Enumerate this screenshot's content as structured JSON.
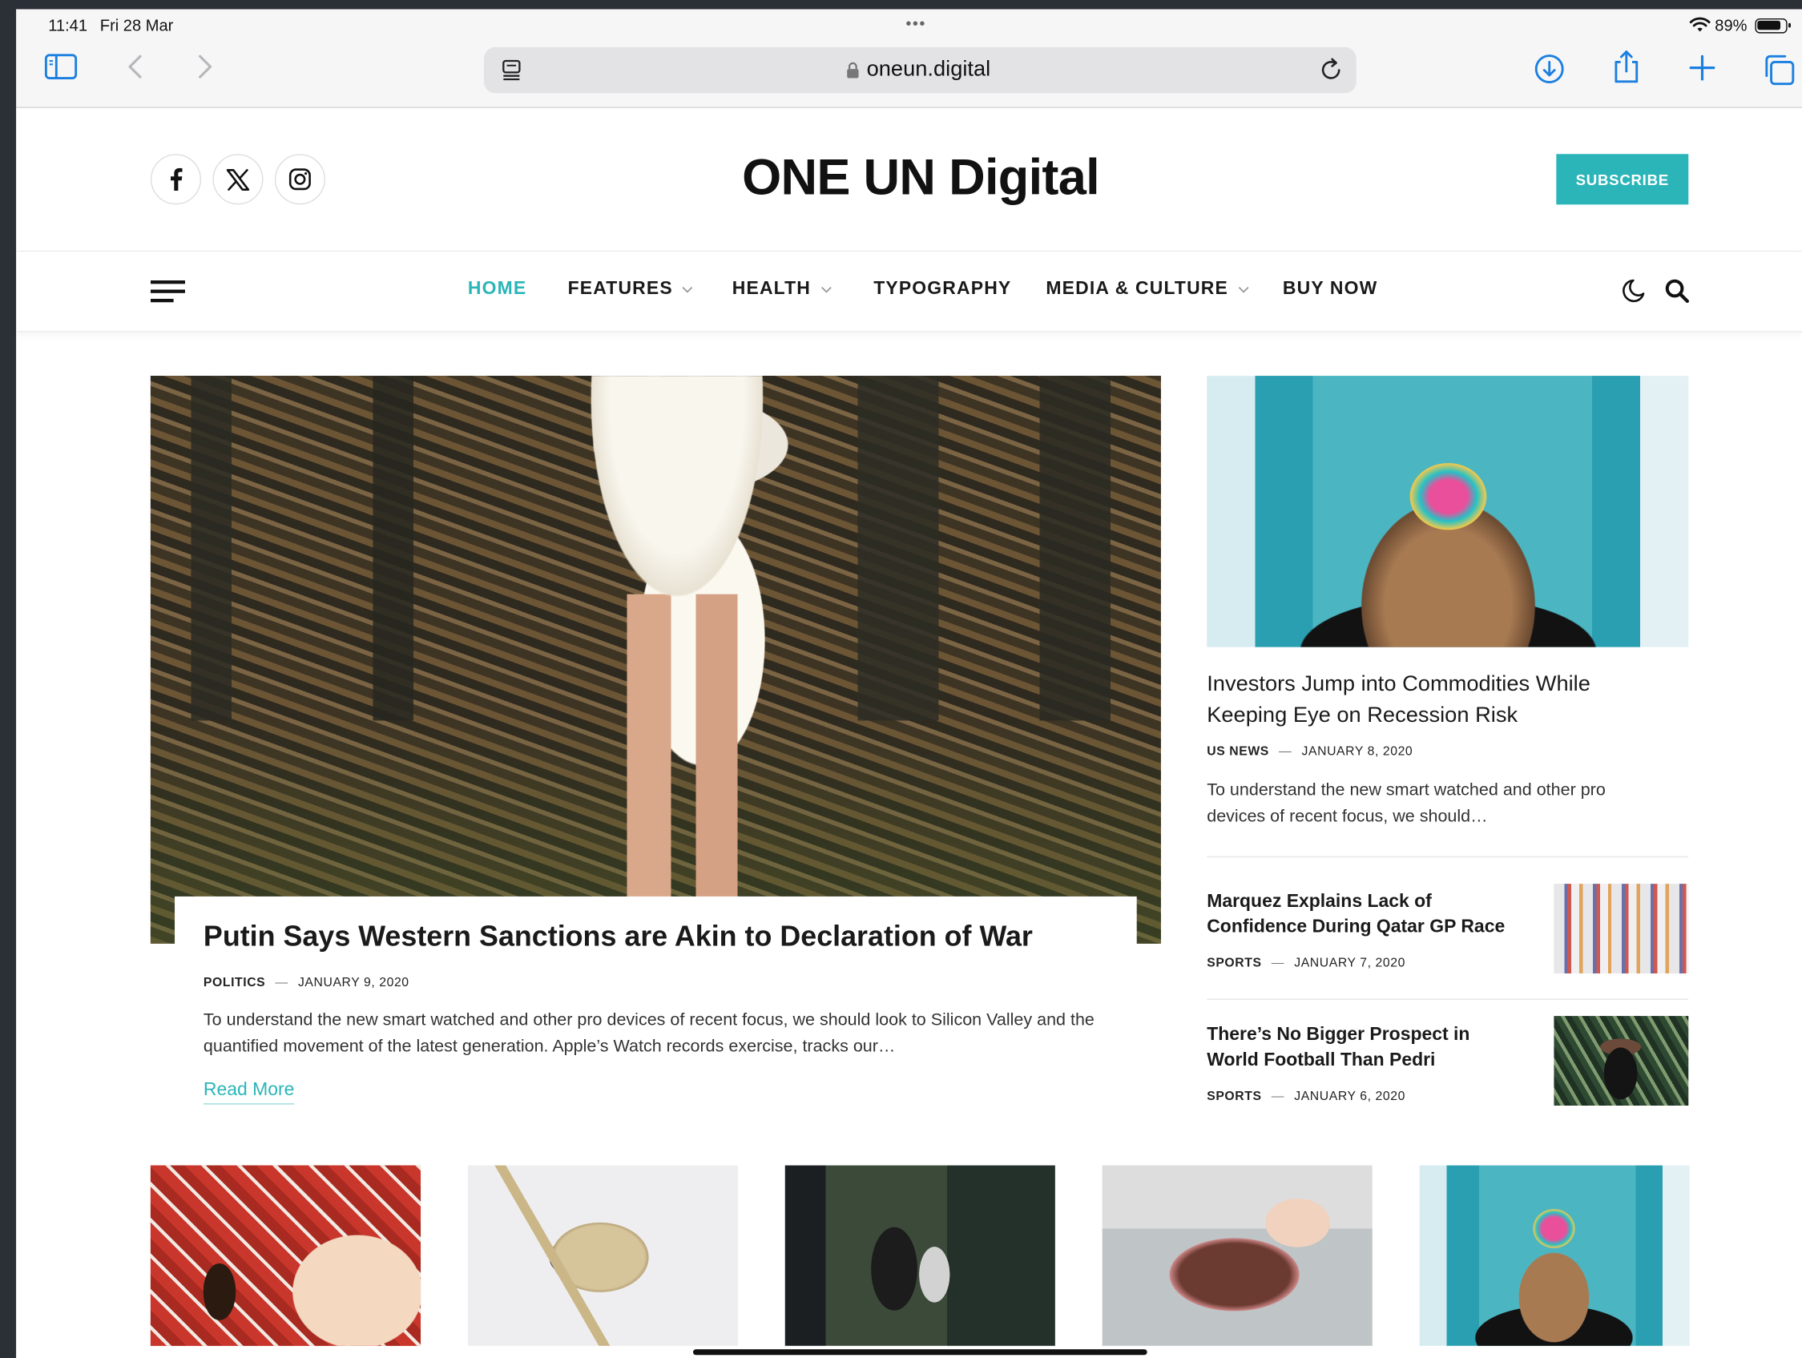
{
  "status_bar": {
    "time": "11:41",
    "date": "Fri 28 Mar",
    "battery": "89%",
    "more_dots": "•••"
  },
  "browser": {
    "url": "oneun.digital",
    "icons": [
      "sidebar-icon",
      "back-icon",
      "forward-icon",
      "reader-icon",
      "lock-icon",
      "reload-icon",
      "downloads-icon",
      "share-icon",
      "new-tab-icon",
      "tabs-icon"
    ]
  },
  "header": {
    "site_title": "ONE UN Digital",
    "subscribe_label": "SUBSCRIBE",
    "social_icons": [
      "facebook-icon",
      "x-icon",
      "instagram-icon"
    ]
  },
  "nav": {
    "items": [
      {
        "label": "HOME",
        "active": true,
        "dropdown": false
      },
      {
        "label": "FEATURES",
        "active": false,
        "dropdown": true
      },
      {
        "label": "HEALTH",
        "active": false,
        "dropdown": true
      },
      {
        "label": "TYPOGRAPHY",
        "active": false,
        "dropdown": false
      },
      {
        "label": "MEDIA & CULTURE",
        "active": false,
        "dropdown": true
      },
      {
        "label": "BUY NOW",
        "active": false,
        "dropdown": false
      }
    ],
    "icons": [
      "hamburger-icon",
      "moon-icon",
      "search-icon"
    ]
  },
  "hero": {
    "title": "Putin Says Western Sanctions are Akin to Declaration of War",
    "category": "POLITICS",
    "separator": "—",
    "date": "JANUARY 9, 2020",
    "excerpt": "To understand the new smart watched and other pro devices of recent focus, we should look to Silicon Valley and the quantified movement of the latest generation. Apple’s Watch records exercise, tracks our…",
    "read_more": "Read More"
  },
  "side_feature": {
    "title": "Investors Jump into Commodities While Keeping Eye on Recession Risk",
    "category": "US NEWS",
    "date": "JANUARY 8, 2020",
    "excerpt": "To understand the new smart watched and other pro devices of recent focus, we should…"
  },
  "side_posts": [
    {
      "title": "Marquez Explains Lack of Confidence During Qatar GP Race",
      "category": "SPORTS",
      "date": "JANUARY 7, 2020"
    },
    {
      "title": "There’s No Bigger Prospect in World Football Than Pedri",
      "category": "SPORTS",
      "date": "JANUARY 6, 2020"
    }
  ],
  "colors": {
    "accent": "#2bb5b8",
    "text": "#1a1a1a",
    "chrome_bg": "#f6f6f7",
    "address_bar_bg": "#e3e3e6",
    "browser_blue": "#1a7fe0"
  }
}
